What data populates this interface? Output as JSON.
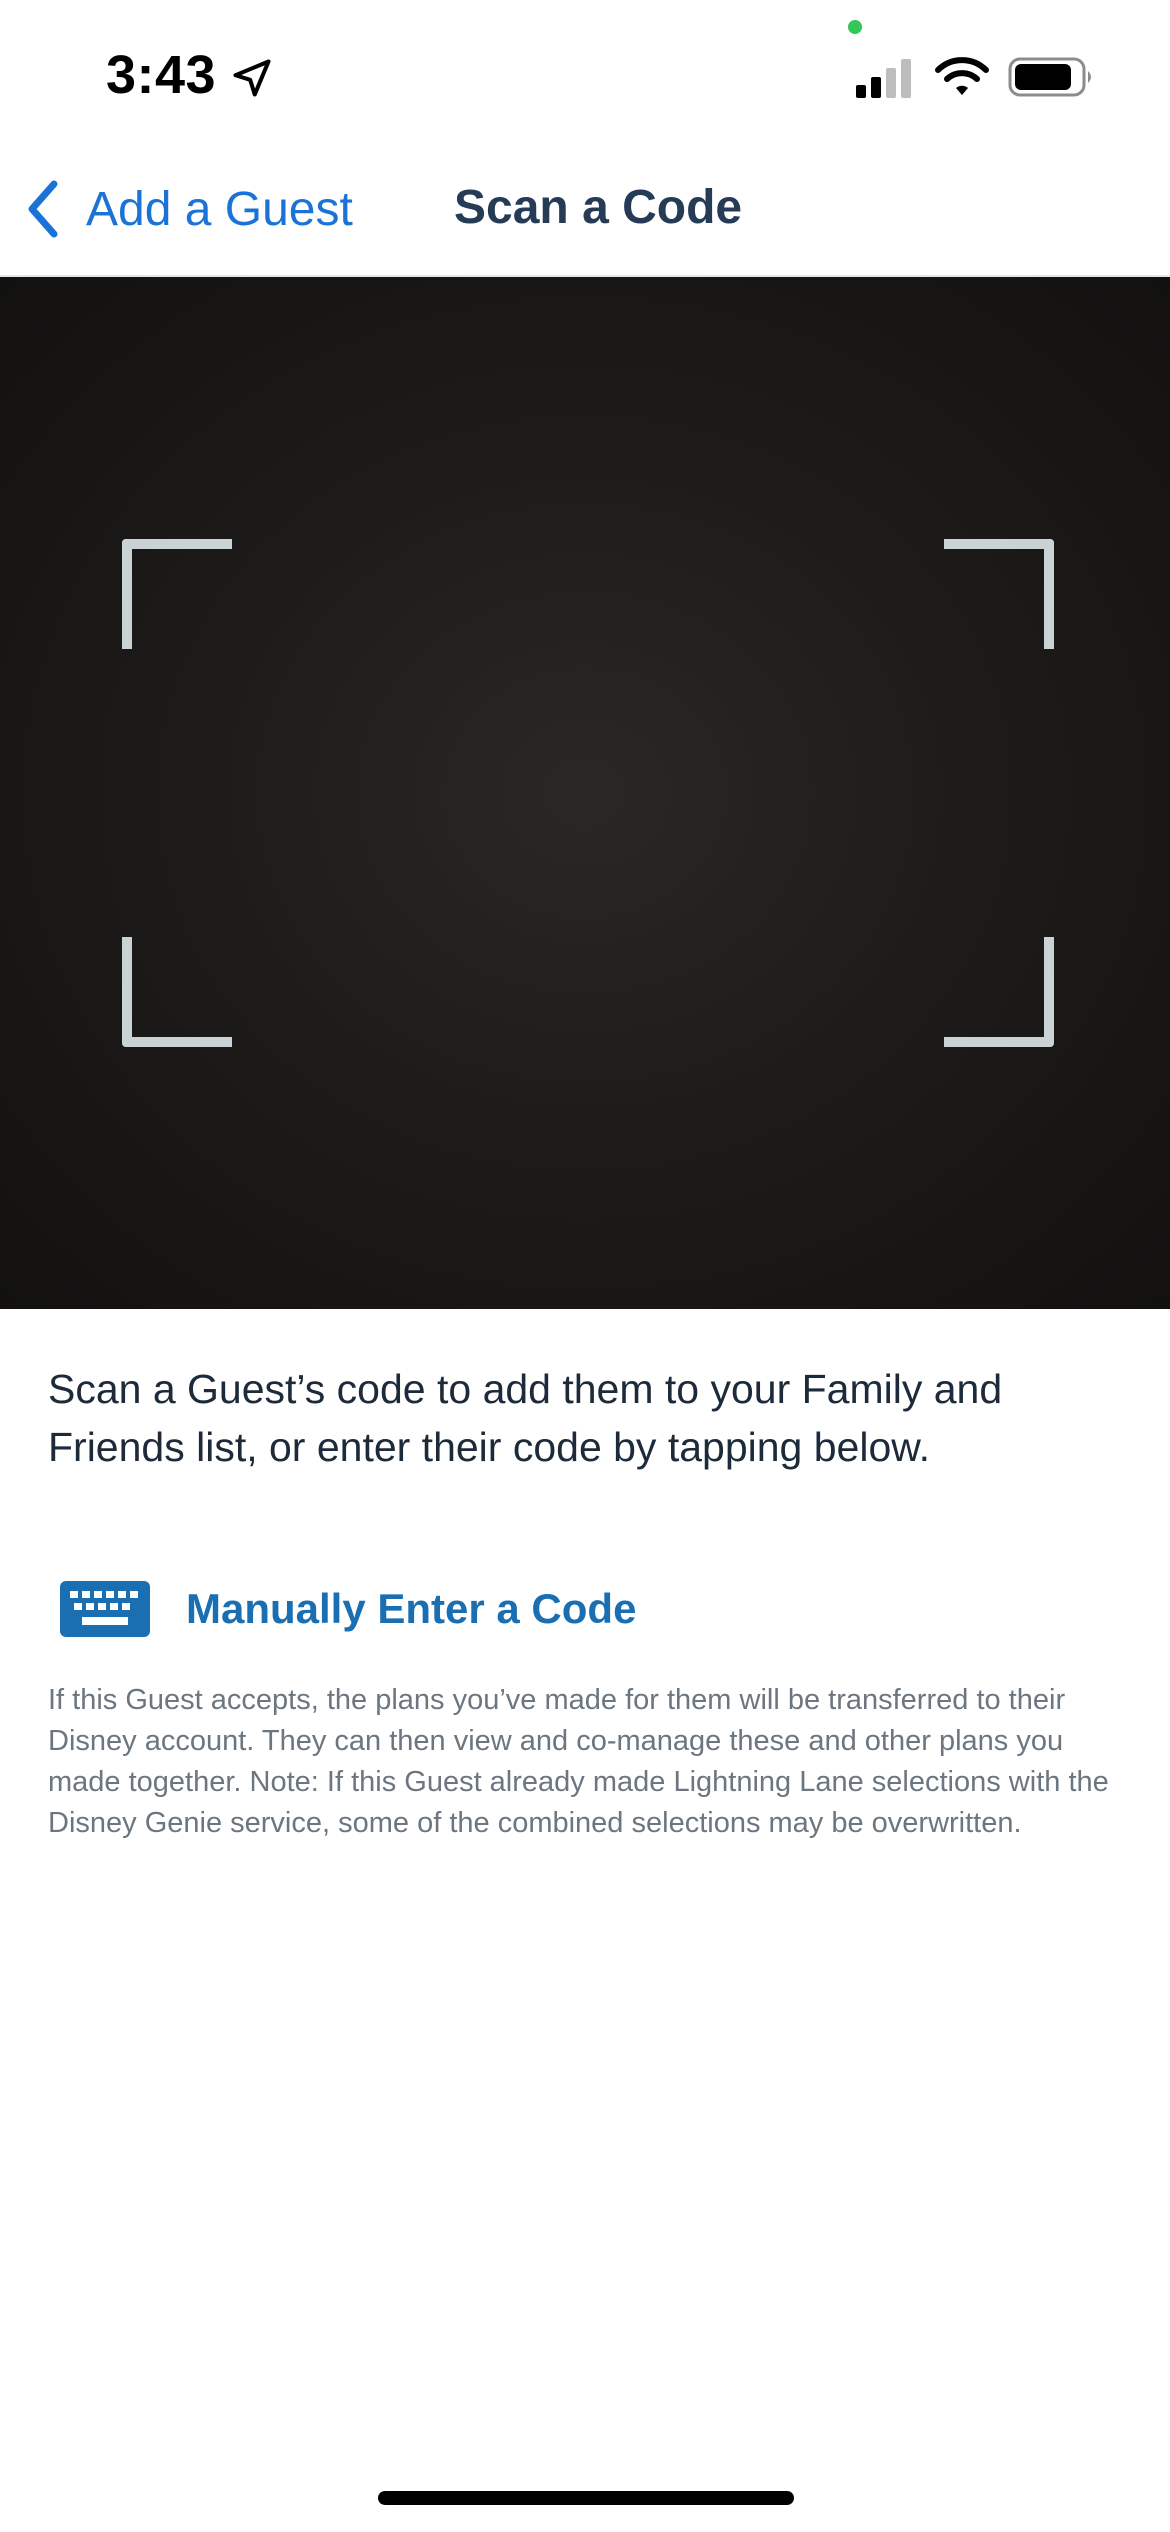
{
  "status_bar": {
    "time": "3:43",
    "icons": [
      "location-arrow-icon",
      "signal-icon",
      "wifi-icon",
      "battery-icon"
    ]
  },
  "nav": {
    "back_label": "Add a Guest",
    "title": "Scan a Code",
    "accent_color": "#1b73d8"
  },
  "main": {
    "instructions": "Scan a Guest’s code to add them to your Family and Friends list, or enter their code by tapping below.",
    "manual_entry_label": "Manually Enter a Code",
    "manual_entry_icon": "keyboard-icon",
    "note": "If this Guest accepts, the plans you’ve made for them will be transferred to their Disney account. They can then view and co-manage these and other plans you made together. Note: If this Guest already made Lightning Lane selections with the Disney Genie service, some of the combined selections may be overwritten."
  }
}
